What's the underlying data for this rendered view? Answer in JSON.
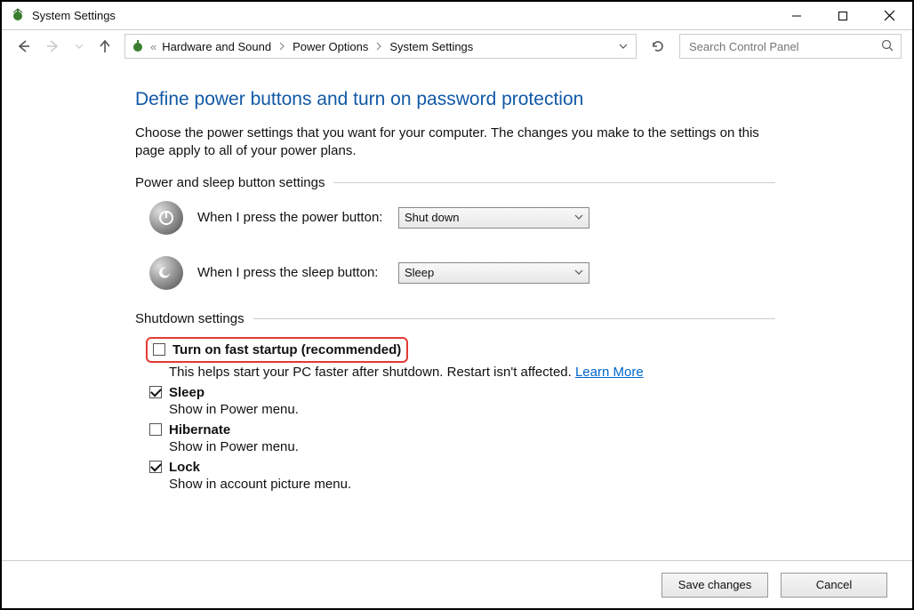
{
  "window": {
    "title": "System Settings"
  },
  "breadcrumb": {
    "item0": "Hardware and Sound",
    "item1": "Power Options",
    "item2": "System Settings"
  },
  "search": {
    "placeholder": "Search Control Panel"
  },
  "page": {
    "heading": "Define power buttons and turn on password protection",
    "description": "Choose the power settings that you want for your computer. The changes you make to the settings on this page apply to all of your power plans."
  },
  "sections": {
    "power_sleep_heading": "Power and sleep button settings",
    "shutdown_heading": "Shutdown settings"
  },
  "power_button": {
    "label": "When I press the power button:",
    "value": "Shut down"
  },
  "sleep_button": {
    "label": "When I press the sleep button:",
    "value": "Sleep"
  },
  "shutdown": {
    "fast_startup": {
      "label": "Turn on fast startup (recommended)",
      "desc": "This helps start your PC faster after shutdown. Restart isn't affected. ",
      "learn_more": "Learn More",
      "checked": false
    },
    "sleep": {
      "label": "Sleep",
      "desc": "Show in Power menu.",
      "checked": true
    },
    "hibernate": {
      "label": "Hibernate",
      "desc": "Show in Power menu.",
      "checked": false
    },
    "lock": {
      "label": "Lock",
      "desc": "Show in account picture menu.",
      "checked": true
    }
  },
  "footer": {
    "save": "Save changes",
    "cancel": "Cancel"
  }
}
